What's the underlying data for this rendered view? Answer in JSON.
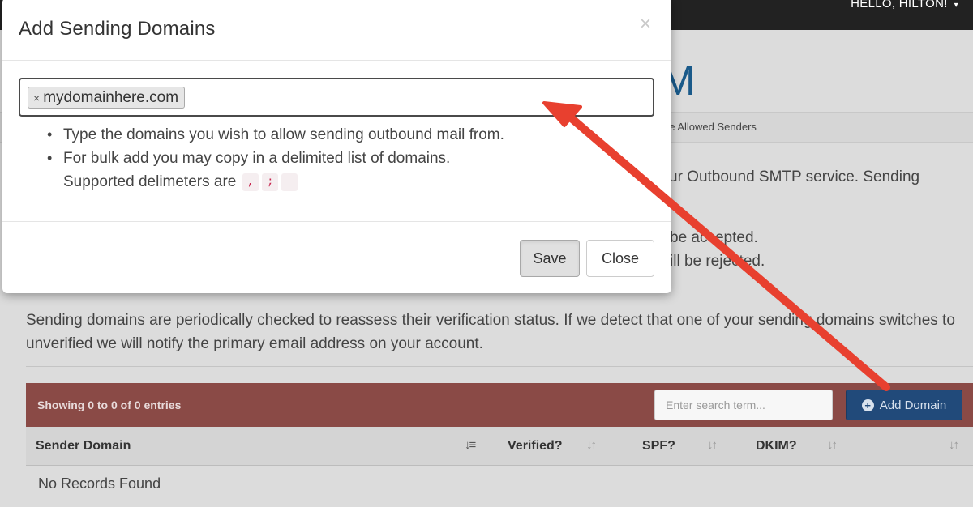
{
  "navbar": {
    "user_greeting": "HELLO, HILTON!",
    "caret": "▾"
  },
  "page": {
    "heading_fragment": "IM",
    "breadcrumb_fragment": "ge Allowed Senders",
    "intro_fragment": "ur Outbound SMTP service. Sending",
    "rule_accepted_fragment": "be accepted.",
    "rule_rejected_fragment": "ill be rejected.",
    "periodic_text": "Sending domains are periodically checked to reassess their verification status. If we detect that one of your sending domains switches to unverified we will notify the primary email address on your account."
  },
  "table": {
    "entries_info": "Showing 0 to 0 of 0 entries",
    "search_placeholder": "Enter search term...",
    "add_domain_label": "Add Domain",
    "columns": [
      "Sender Domain",
      "Verified?",
      "SPF?",
      "DKIM?"
    ],
    "empty_message": "No Records Found"
  },
  "modal": {
    "title": "Add Sending Domains",
    "close_symbol": "×",
    "tags": [
      {
        "label": "mydomainhere.com",
        "remove_symbol": "×"
      }
    ],
    "help_items": [
      "Type the domains you wish to allow sending outbound mail from.",
      "For bulk add you may copy in a delimited list of domains."
    ],
    "delimiters_label": "Supported delimeters are",
    "delimiters": [
      ",",
      ";",
      " "
    ],
    "save_label": "Save",
    "close_label": "Close"
  },
  "colors": {
    "arrow": "#e8402f",
    "toolbar": "#8a4a46",
    "add_button": "#214a7a",
    "heading": "#1a5a8a"
  },
  "icons": {
    "add": "plus-circle-icon",
    "sort_active": "sort-amount-down-icon",
    "sort": "sort-arrows-icon",
    "caret": "caret-down-icon"
  }
}
